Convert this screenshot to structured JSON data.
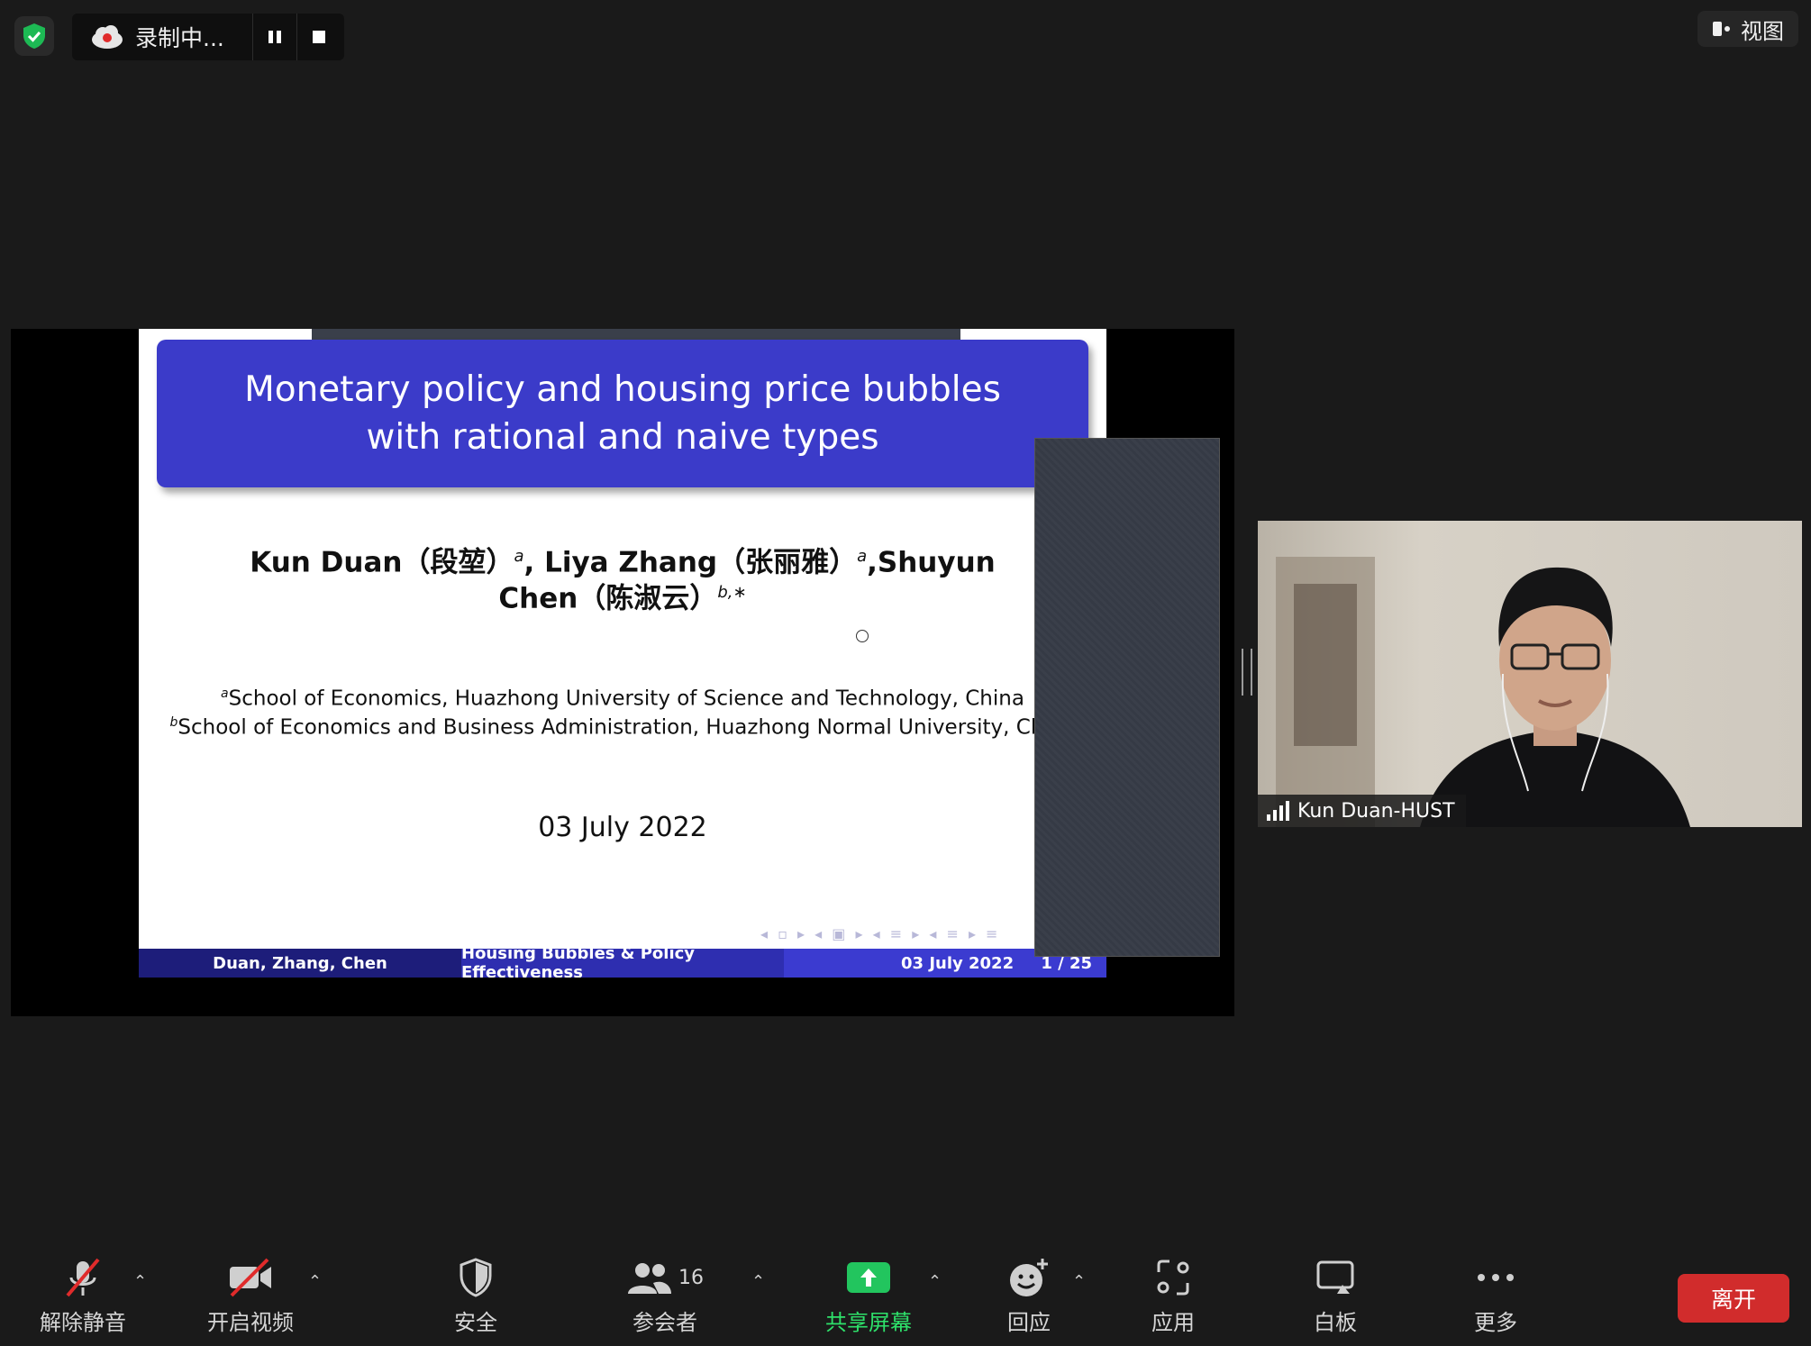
{
  "recording": {
    "label": "录制中..."
  },
  "view_button": {
    "label": "视图"
  },
  "slide": {
    "title_line1": "Monetary policy and housing price bubbles",
    "title_line2": "with rational and naive types",
    "authors_line1_a": "Kun Duan（段堃）",
    "authors_line1_a_sup": "a",
    "authors_line1_b": ", Liya Zhang（张丽雅）",
    "authors_line1_b_sup": "a",
    "authors_line1_c": ",Shuyun",
    "authors_line2": "Chen（陈淑云）",
    "authors_line2_sup": "b,∗",
    "affil_a_sup": "a",
    "affil_a": "School of Economics, Huazhong University of Science and Technology, China",
    "affil_b_sup": "b",
    "affil_b": "School of Economics and Business Administration, Huazhong Normal University, China",
    "date": "03 July 2022",
    "footer_authors": "Duan, Zhang, Chen",
    "footer_title": "Housing Bubbles & Policy Effectiveness",
    "footer_date": "03 July 2022",
    "footer_page": "1 / 25"
  },
  "participant": {
    "name": "Kun Duan-HUST"
  },
  "toolbar": {
    "unmute": "解除静音",
    "start_video": "开启视频",
    "security": "安全",
    "participants": "参会者",
    "participants_count": "16",
    "share_screen": "共享屏幕",
    "reactions": "回应",
    "apps": "应用",
    "whiteboard": "白板",
    "more": "更多",
    "leave": "离开"
  },
  "colors": {
    "title_box": "#3b3bc9",
    "leave": "#d12c2c",
    "share_green": "#22c55e",
    "shield_green": "#1db954"
  }
}
